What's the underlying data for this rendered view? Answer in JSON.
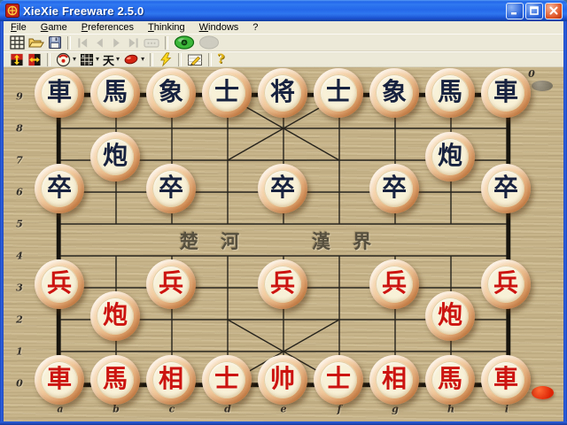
{
  "window": {
    "title": "XieXie Freeware 2.5.0"
  },
  "menu": {
    "items": [
      {
        "label": "File"
      },
      {
        "label": "Game"
      },
      {
        "label": "Preferences"
      },
      {
        "label": "Thinking"
      },
      {
        "label": "Windows"
      },
      {
        "label": "?"
      }
    ]
  },
  "toolbar_main": {
    "buttons": [
      {
        "name": "new-board",
        "enabled": true
      },
      {
        "name": "open",
        "enabled": true
      },
      {
        "name": "save",
        "enabled": true
      },
      {
        "name": "go-first",
        "enabled": false
      },
      {
        "name": "go-previous",
        "enabled": false
      },
      {
        "name": "go-next",
        "enabled": false
      },
      {
        "name": "go-last",
        "enabled": false
      },
      {
        "name": "replay",
        "enabled": false
      },
      {
        "name": "engine-go",
        "enabled": true
      },
      {
        "name": "engine-stop",
        "enabled": false
      }
    ]
  },
  "toolbar_style": {
    "buttons": [
      {
        "name": "flip-board-vertical",
        "enabled": true
      },
      {
        "name": "flip-board-horizontal",
        "enabled": true
      },
      {
        "name": "piece-set",
        "enabled": true,
        "dropdown": true
      },
      {
        "name": "board-style",
        "enabled": true,
        "dropdown": true
      },
      {
        "name": "black-piece-font",
        "enabled": true,
        "dropdown": true
      },
      {
        "name": "red-piece-font",
        "enabled": true,
        "dropdown": true
      },
      {
        "name": "move-now",
        "enabled": true
      },
      {
        "name": "setup-position",
        "enabled": true
      },
      {
        "name": "help",
        "enabled": true
      }
    ]
  },
  "icons": {
    "dropdown_arrow": "▾",
    "black_piece_font_glyph": "天",
    "help_glyph": "?"
  },
  "board": {
    "rank_labels": [
      "9",
      "8",
      "7",
      "6",
      "5",
      "4",
      "3",
      "2",
      "1",
      "0"
    ],
    "file_labels": [
      "a",
      "b",
      "c",
      "d",
      "e",
      "f",
      "g",
      "h",
      "i"
    ],
    "river_text_left": "楚 河",
    "river_text_right": "漢 界",
    "move_number": "0",
    "side_to_move": "red",
    "pieces": [
      {
        "pos": "a9",
        "char": "車",
        "side": "black"
      },
      {
        "pos": "b9",
        "char": "馬",
        "side": "black"
      },
      {
        "pos": "c9",
        "char": "象",
        "side": "black"
      },
      {
        "pos": "d9",
        "char": "士",
        "side": "black"
      },
      {
        "pos": "e9",
        "char": "将",
        "side": "black"
      },
      {
        "pos": "f9",
        "char": "士",
        "side": "black"
      },
      {
        "pos": "g9",
        "char": "象",
        "side": "black"
      },
      {
        "pos": "h9",
        "char": "馬",
        "side": "black"
      },
      {
        "pos": "i9",
        "char": "車",
        "side": "black"
      },
      {
        "pos": "b7",
        "char": "炮",
        "side": "black"
      },
      {
        "pos": "h7",
        "char": "炮",
        "side": "black"
      },
      {
        "pos": "a6",
        "char": "卒",
        "side": "black"
      },
      {
        "pos": "c6",
        "char": "卒",
        "side": "black"
      },
      {
        "pos": "e6",
        "char": "卒",
        "side": "black"
      },
      {
        "pos": "g6",
        "char": "卒",
        "side": "black"
      },
      {
        "pos": "i6",
        "char": "卒",
        "side": "black"
      },
      {
        "pos": "a3",
        "char": "兵",
        "side": "red"
      },
      {
        "pos": "c3",
        "char": "兵",
        "side": "red"
      },
      {
        "pos": "e3",
        "char": "兵",
        "side": "red"
      },
      {
        "pos": "g3",
        "char": "兵",
        "side": "red"
      },
      {
        "pos": "i3",
        "char": "兵",
        "side": "red"
      },
      {
        "pos": "b2",
        "char": "炮",
        "side": "red"
      },
      {
        "pos": "h2",
        "char": "炮",
        "side": "red"
      },
      {
        "pos": "a0",
        "char": "車",
        "side": "red"
      },
      {
        "pos": "b0",
        "char": "馬",
        "side": "red"
      },
      {
        "pos": "c0",
        "char": "相",
        "side": "red"
      },
      {
        "pos": "d0",
        "char": "士",
        "side": "red"
      },
      {
        "pos": "e0",
        "char": "帅",
        "side": "red"
      },
      {
        "pos": "f0",
        "char": "士",
        "side": "red"
      },
      {
        "pos": "g0",
        "char": "相",
        "side": "red"
      },
      {
        "pos": "h0",
        "char": "馬",
        "side": "red"
      },
      {
        "pos": "i0",
        "char": "車",
        "side": "red"
      }
    ]
  },
  "colors": {
    "title_bar_blue": "#2f77ef",
    "window_border_blue": "#2f62e0",
    "toolbar_background": "#ece9d8",
    "board_wood": "#c7b48a",
    "grid_line": "#26231c",
    "red_piece_text": "#cc1410",
    "black_piece_text": "#17223f",
    "piece_rim": "#ca7a3e",
    "piece_face": "#f8f1d8",
    "turn_indicator_red": "#dd2405",
    "turn_indicator_idle": "#8a8375",
    "river_text": "#57503f"
  }
}
